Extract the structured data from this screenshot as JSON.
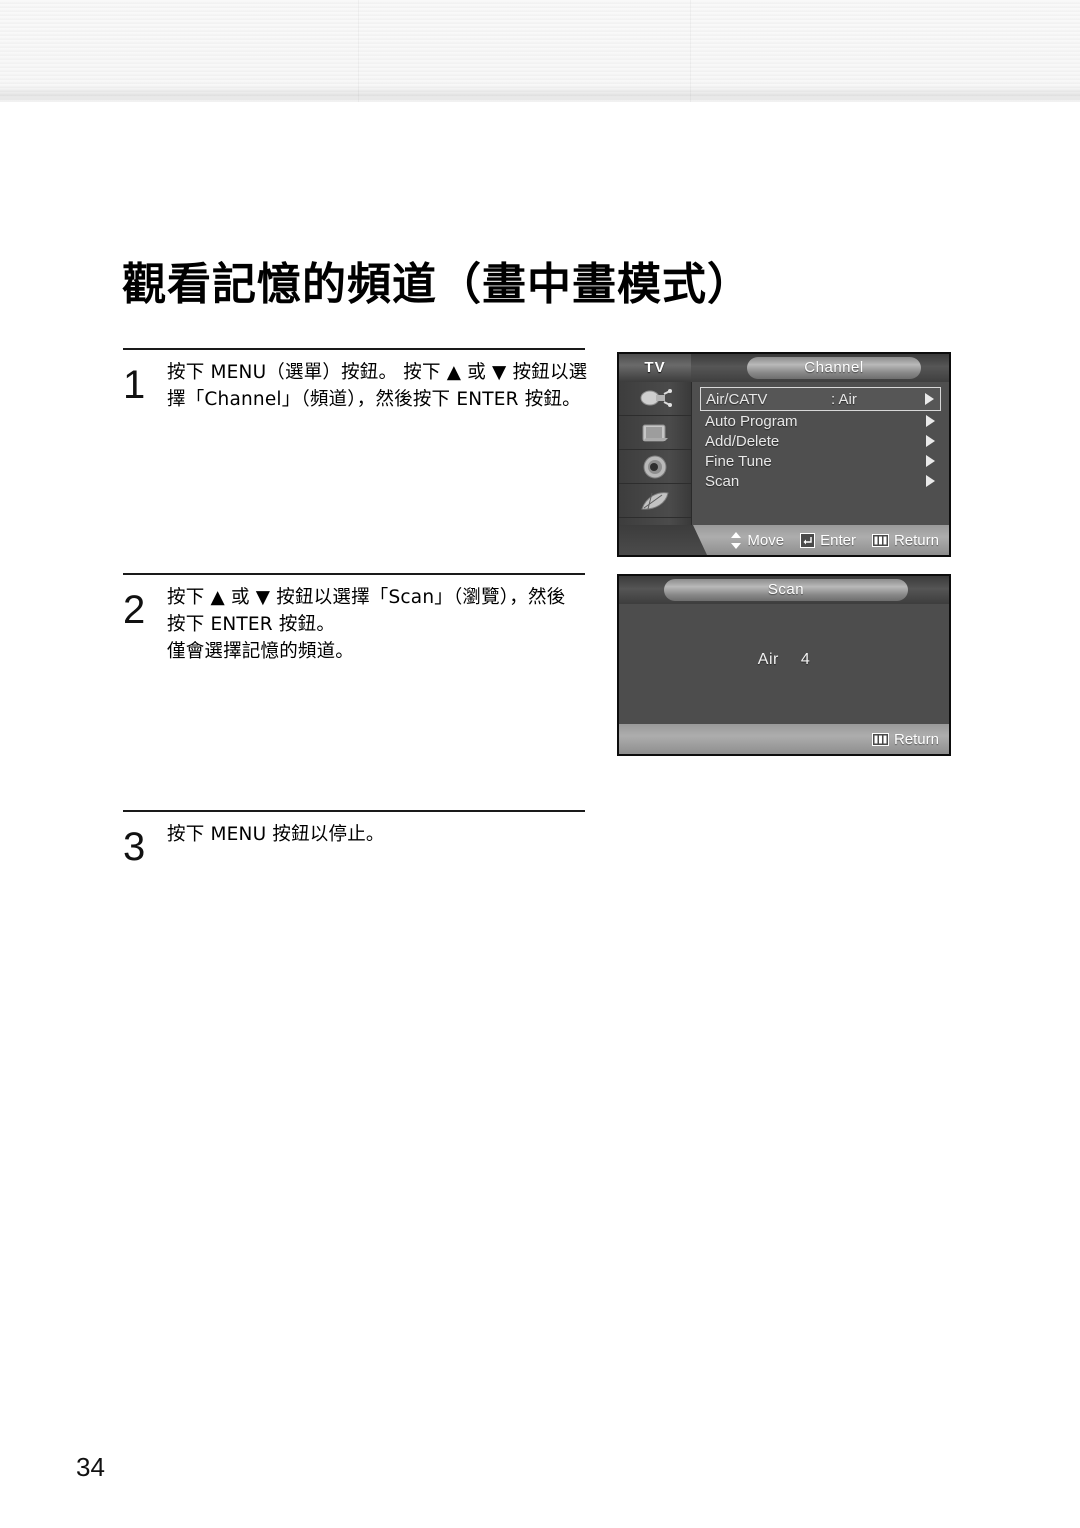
{
  "page": {
    "title": "觀看記憶的頻道（畫中畫模式）",
    "number": "34"
  },
  "steps": [
    {
      "number": "1",
      "lines": [
        "按下 MENU（選單）按鈕。 按下 ▲ 或 ▼ 按鈕以選",
        "擇「Channel」（頻道），然後按下 ENTER 按鈕。"
      ]
    },
    {
      "number": "2",
      "lines": [
        "按下 ▲ 或 ▼ 按鈕以選擇「Scan」（瀏覽），然後",
        "按下 ENTER 按鈕。",
        "僅會選擇記憶的頻道。"
      ]
    },
    {
      "number": "3",
      "lines": [
        "按下 MENU 按鈕以停止。"
      ]
    }
  ],
  "osd_channel": {
    "source_label": "TV",
    "title": "Channel",
    "rail_icons": [
      "input-plug-icon",
      "picture-tv-icon",
      "sound-speaker-icon",
      "setup-tools-icon",
      "pip-multi-icon"
    ],
    "rows": [
      {
        "label": "Air/CATV",
        "value": ": Air",
        "arrow": "►",
        "selected": true
      },
      {
        "label": "Auto Program",
        "value": "",
        "arrow": "►",
        "selected": false
      },
      {
        "label": "Add/Delete",
        "value": "",
        "arrow": "►",
        "selected": false
      },
      {
        "label": "Fine Tune",
        "value": "",
        "arrow": "►",
        "selected": false
      },
      {
        "label": "Scan",
        "value": "",
        "arrow": "►",
        "selected": false
      }
    ],
    "footer": [
      {
        "icon": "up-down-arrow-icon",
        "label": "Move"
      },
      {
        "icon": "enter-key-icon",
        "label": "Enter"
      },
      {
        "icon": "menu-key-icon",
        "label": "Return"
      }
    ]
  },
  "osd_scan": {
    "title": "Scan",
    "band": "Air",
    "channel": "4",
    "footer": [
      {
        "icon": "menu-key-icon",
        "label": "Return"
      }
    ]
  }
}
